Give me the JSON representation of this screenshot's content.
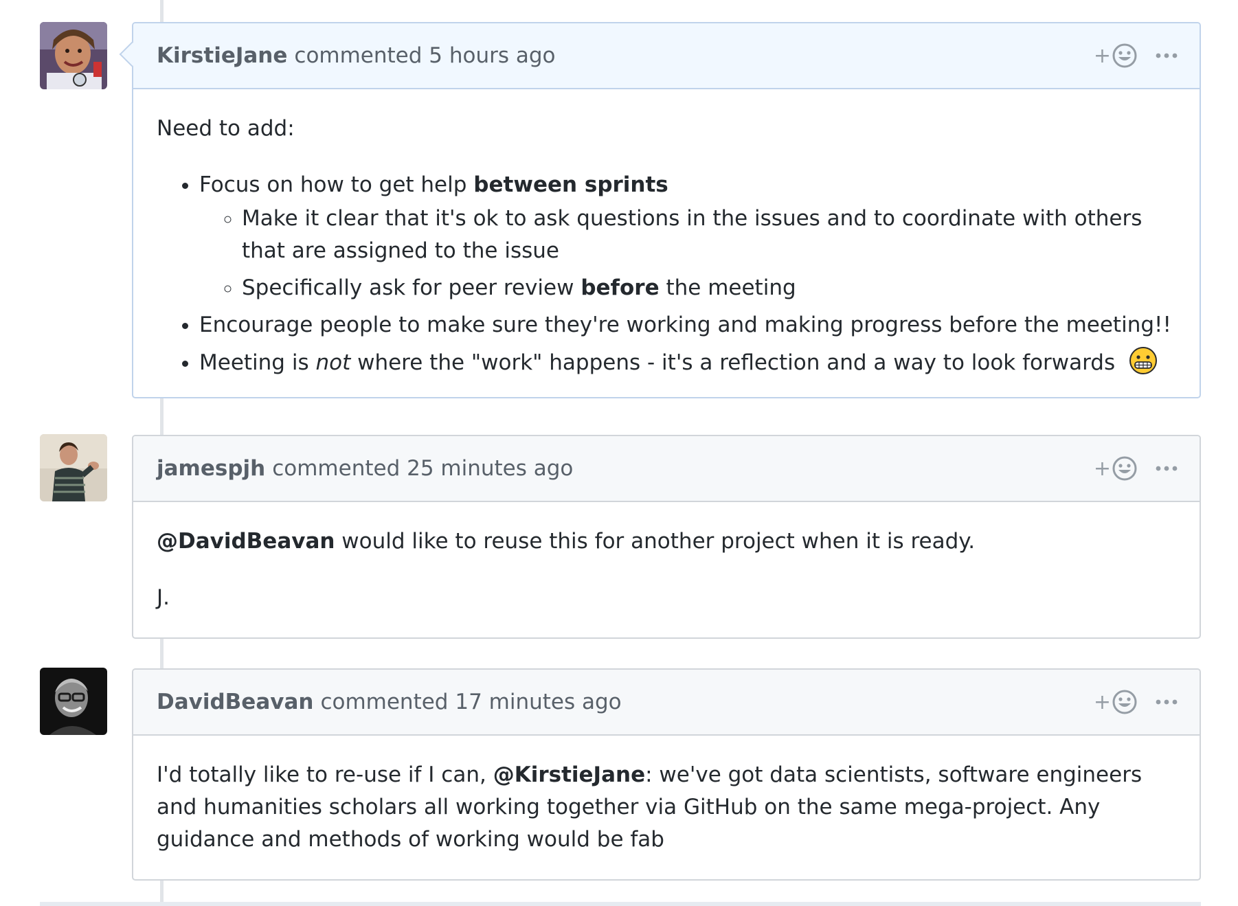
{
  "comments": [
    {
      "author": "KirstieJane",
      "action": "commented",
      "time": "5 hours ago",
      "avatar_icon": "avatar-kirstiejane",
      "intro": "Need to add:",
      "items": [
        {
          "text_before": "Focus on how to get help ",
          "bold": "between sprints",
          "subitems": [
            {
              "text": "Make it clear that it's ok to ask questions in the issues and to coordinate with others that are assigned to the issue"
            },
            {
              "text_before": "Specifically ask for peer review ",
              "bold": "before",
              "text_after": " the meeting"
            }
          ]
        },
        {
          "text": "Encourage people to make sure they're working and making progress before the meeting!!"
        },
        {
          "text_before": "Meeting is ",
          "italic": "not",
          "text_after": " where the \"work\" happens - it's a reflection and a way to look forwards",
          "emoji": "grimacing-emoji-icon"
        }
      ]
    },
    {
      "author": "jamespjh",
      "action": "commented",
      "time": "25 minutes ago",
      "avatar_icon": "avatar-jamespjh",
      "mention": "@DavidBeavan",
      "line1_rest": " would like to reuse this for another project when it is ready.",
      "signoff": "J."
    },
    {
      "author": "DavidBeavan",
      "action": "commented",
      "time": "17 minutes ago",
      "avatar_icon": "avatar-davidbeavan",
      "text_before": "I'd totally like to re-use if I can, ",
      "mention": "@KirstieJane",
      "text_after": ": we've got data scientists, software engineers and humanities scholars all working together via GitHub on the same mega-project. Any guidance and methods of working would be fab"
    }
  ],
  "header_icons": {
    "reaction": "add-reaction-smiley-icon",
    "plus": "+",
    "more": "kebab-horizontal-icon"
  },
  "colors": {
    "highlight_header": "#f1f8ff",
    "header": "#f6f8fa",
    "border": "#d1d5da",
    "highlight_border": "#c0d3eb",
    "muted_text": "#586069"
  }
}
